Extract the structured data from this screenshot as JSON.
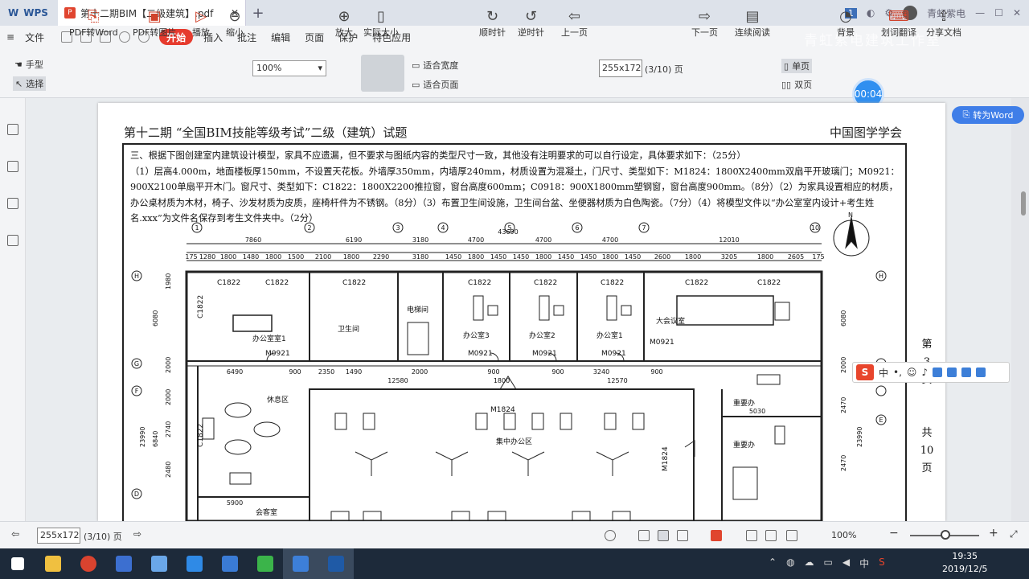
{
  "app": {
    "name": "WPS"
  },
  "tab": {
    "title": "第十二期BIM【二级建筑】.pdf",
    "close": "✕",
    "add": "+"
  },
  "topright": {
    "badge": "1",
    "user": "青虹紫电"
  },
  "watermark": "青虹紫电建筑工作室",
  "menu": {
    "file": "文件",
    "items": [
      "开始",
      "插入",
      "批注",
      "编辑",
      "页面",
      "保护",
      "特色应用"
    ]
  },
  "toolbar": {
    "hand": "手型",
    "select": "选择",
    "pdf2word": "PDF转Word",
    "pdf2img": "PDF转图片",
    "play": "播放",
    "zoomout": "缩小",
    "zoom_value": "100%",
    "zoomin": "放大",
    "actual_size": "实际大小",
    "fit_width": "适合宽度",
    "fit_page": "适合页面",
    "rotate_cw": "顺时针",
    "rotate_ccw": "逆时针",
    "prev_page": "上一页",
    "page_box": "255x172",
    "page_count": "(3/10) 页",
    "next_page": "下一页",
    "continuous": "连续阅读",
    "single": "单页",
    "double": "双页",
    "background": "背景",
    "translate": "划词翻译",
    "share": "分享文档"
  },
  "timer": "00:04",
  "to_word": "转为Word",
  "document": {
    "title": "第十二期 “全国BIM技能等级考试”二级（建筑）试题",
    "org": "中国图学学会",
    "requirements": [
      "三、根据下图创建室内建筑设计模型，家具不应遗漏，但不要求与图纸内容的类型尺寸一致，其他没有注明要求的可以自行设定，具体要求如下：（25分）",
      "（1）层高4.000m，地面楼板厚150mm，不设置天花板。外墙厚350mm，内墙厚240mm，材质设置为混凝土，门尺寸、类型如下：M1824：1800X2400mm双扇平开玻璃门；M0921：900X2100单扇平开木门。窗尺寸、类型如下：C1822：1800X2200推拉窗，窗台高度600mm；C0918：900X1800mm塑钢窗，窗台高度900mm。（8分）（2）为家具设置相应的材质，办公桌材质为木材，椅子、沙发材质为皮质，座椅杆件为不锈钢。（8分）（3）布置卫生间设施，卫生间台盆、坐便器材质为白色陶瓷。（7分）（4）将模型文件以“办公室室内设计+考生姓名.xxx”为文件名保存到考生文件夹中。（2分）"
    ],
    "side_text": [
      "第",
      "3",
      "页",
      "共",
      "10",
      "页"
    ],
    "grid_labels_top": [
      "1",
      "2",
      "3",
      "4",
      "5",
      "6",
      "7",
      "10"
    ],
    "grid_labels_left": [
      "H",
      "G",
      "F",
      "E",
      "D",
      "C"
    ],
    "dims_row1": [
      "7860",
      "6190",
      "3180",
      "4700",
      "4700",
      "4700",
      "12010"
    ],
    "dims_total": "43690",
    "dims_row2": [
      "175",
      "1280",
      "1800",
      "1480",
      "1800",
      "1500",
      "2100",
      "1800",
      "2290",
      "3180",
      "1450",
      "1800",
      "1450",
      "1450",
      "1800",
      "1450",
      "1450",
      "1800",
      "1450",
      "2600",
      "1800",
      "3205",
      "1800",
      "2605",
      "175"
    ],
    "rooms": [
      "办公室室1",
      "卫生间",
      "电梯间",
      "办公室3",
      "办公室2",
      "办公室1",
      "大会议室",
      "休息区",
      "集中办公区",
      "重要办",
      "重要办",
      "会客室"
    ],
    "window_tags": [
      "C1822",
      "C1822",
      "C1822",
      "C1822",
      "C1822",
      "C1822",
      "C1822",
      "C1822",
      "C1822",
      "C1822"
    ],
    "door_tags": [
      "M0921",
      "M0921",
      "M0921",
      "M0921",
      "M0921",
      "M1824",
      "M1824"
    ],
    "mid_dims": [
      "6490",
      "900",
      "2350",
      "1490",
      "12580",
      "2000",
      "900",
      "1800",
      "900",
      "3240",
      "12570",
      "900",
      "5030",
      "5900"
    ],
    "left_dims": [
      "1980",
      "6080",
      "2000",
      "2000",
      "2740",
      "6840",
      "23990",
      "2480"
    ],
    "right_dims": [
      "6080",
      "2000",
      "2470",
      "2470",
      "23990"
    ]
  },
  "ime": {
    "label": "中"
  },
  "statusbar": {
    "page_box": "255x172",
    "page_count": "(3/10) 页",
    "zoom": "100%"
  },
  "clock": {
    "time": "19:35",
    "date": "2019/12/5"
  },
  "tray": [
    "中"
  ]
}
